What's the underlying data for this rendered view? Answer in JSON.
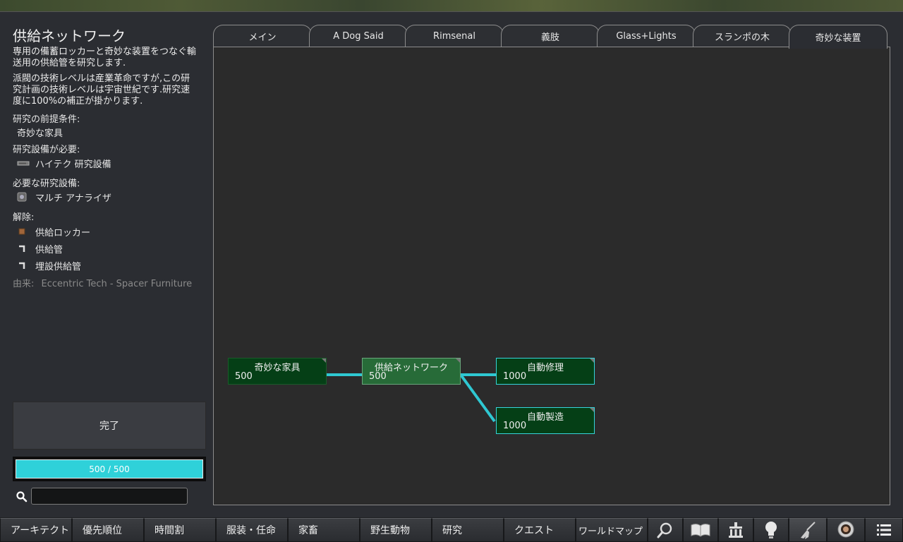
{
  "panel": {
    "title": "供給ネットワーク",
    "description": "専用の備蓄ロッカーと奇妙な装置をつなぐ輸送用の供給管を研究します.",
    "tech_note": "派閥の技術レベルは産業革命ですが,この研究計画の技術レベルは宇宙世紀です.研究速度に100%の補正が掛かります.",
    "prereq_label": "研究の前提条件:",
    "prereq_item": "奇妙な家具",
    "bench_label": "研究設備が必要:",
    "bench_item": "ハイテク 研究設備",
    "facility_label": "必要な研究設備:",
    "facility_item": "マルチ アナライザ",
    "unlock_label": "解除:",
    "unlocks": [
      "供給ロッカー",
      "供給管",
      "埋設供給管"
    ],
    "source_label": "由来:",
    "source_value": "Eccentric Tech - Spacer Furniture",
    "complete_label": "完了",
    "progress_text": "500 / 500",
    "progress_fraction": 1.0,
    "search_placeholder": ""
  },
  "tabs": [
    "メイン",
    "A Dog Said",
    "Rimsenal",
    "義肢",
    "Glass+Lights",
    "スランポの木",
    "奇妙な装置"
  ],
  "active_tab": "奇妙な装置",
  "tree": {
    "nodes": [
      {
        "name": "奇妙な家具",
        "cost": "500"
      },
      {
        "name": "供給ネットワーク",
        "cost": "500"
      },
      {
        "name": "自動修理",
        "cost": "1000"
      },
      {
        "name": "自動製造",
        "cost": "1000"
      }
    ]
  },
  "bottom_bar": {
    "buttons": [
      "アーキテクト",
      "優先順位",
      "時間割",
      "服装・任命",
      "家畜",
      "野生動物",
      "研究",
      "クエスト",
      "ワールドマップ"
    ],
    "icons": [
      "inspect-icon",
      "book-icon",
      "factions-icon",
      "lightbulb-icon",
      "broom-icon",
      "astronaut-icon",
      "menu-icon"
    ]
  },
  "colors": {
    "accent_cyan": "#2fd1d9",
    "node_green": "#053f16",
    "node_current": "#276b38",
    "background": "#2b2d32"
  }
}
